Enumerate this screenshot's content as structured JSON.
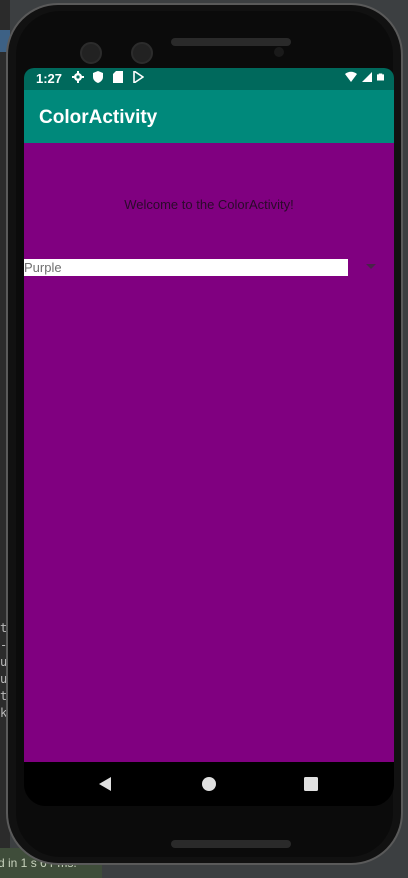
{
  "ide": {
    "side_text": "t\n-\nu\nu\nt\nk",
    "status_text": "d in 1 s 6 r ms."
  },
  "statusbar": {
    "time": "1:27",
    "left_icons": [
      "gear-icon",
      "shield-icon",
      "sd-card-icon",
      "play-store-icon"
    ],
    "right_icons": [
      "wifi-icon",
      "signal-icon",
      "battery-icon"
    ]
  },
  "appbar": {
    "title": "ColorActivity",
    "color": "#00897b",
    "status_color": "#00695c"
  },
  "content": {
    "background_color": "#800080",
    "welcome_text": "Welcome to the ColorActivity!",
    "spinner": {
      "selected_value": "Purple"
    }
  },
  "navbar": {
    "buttons": [
      "back-icon",
      "home-icon",
      "recents-icon"
    ]
  }
}
